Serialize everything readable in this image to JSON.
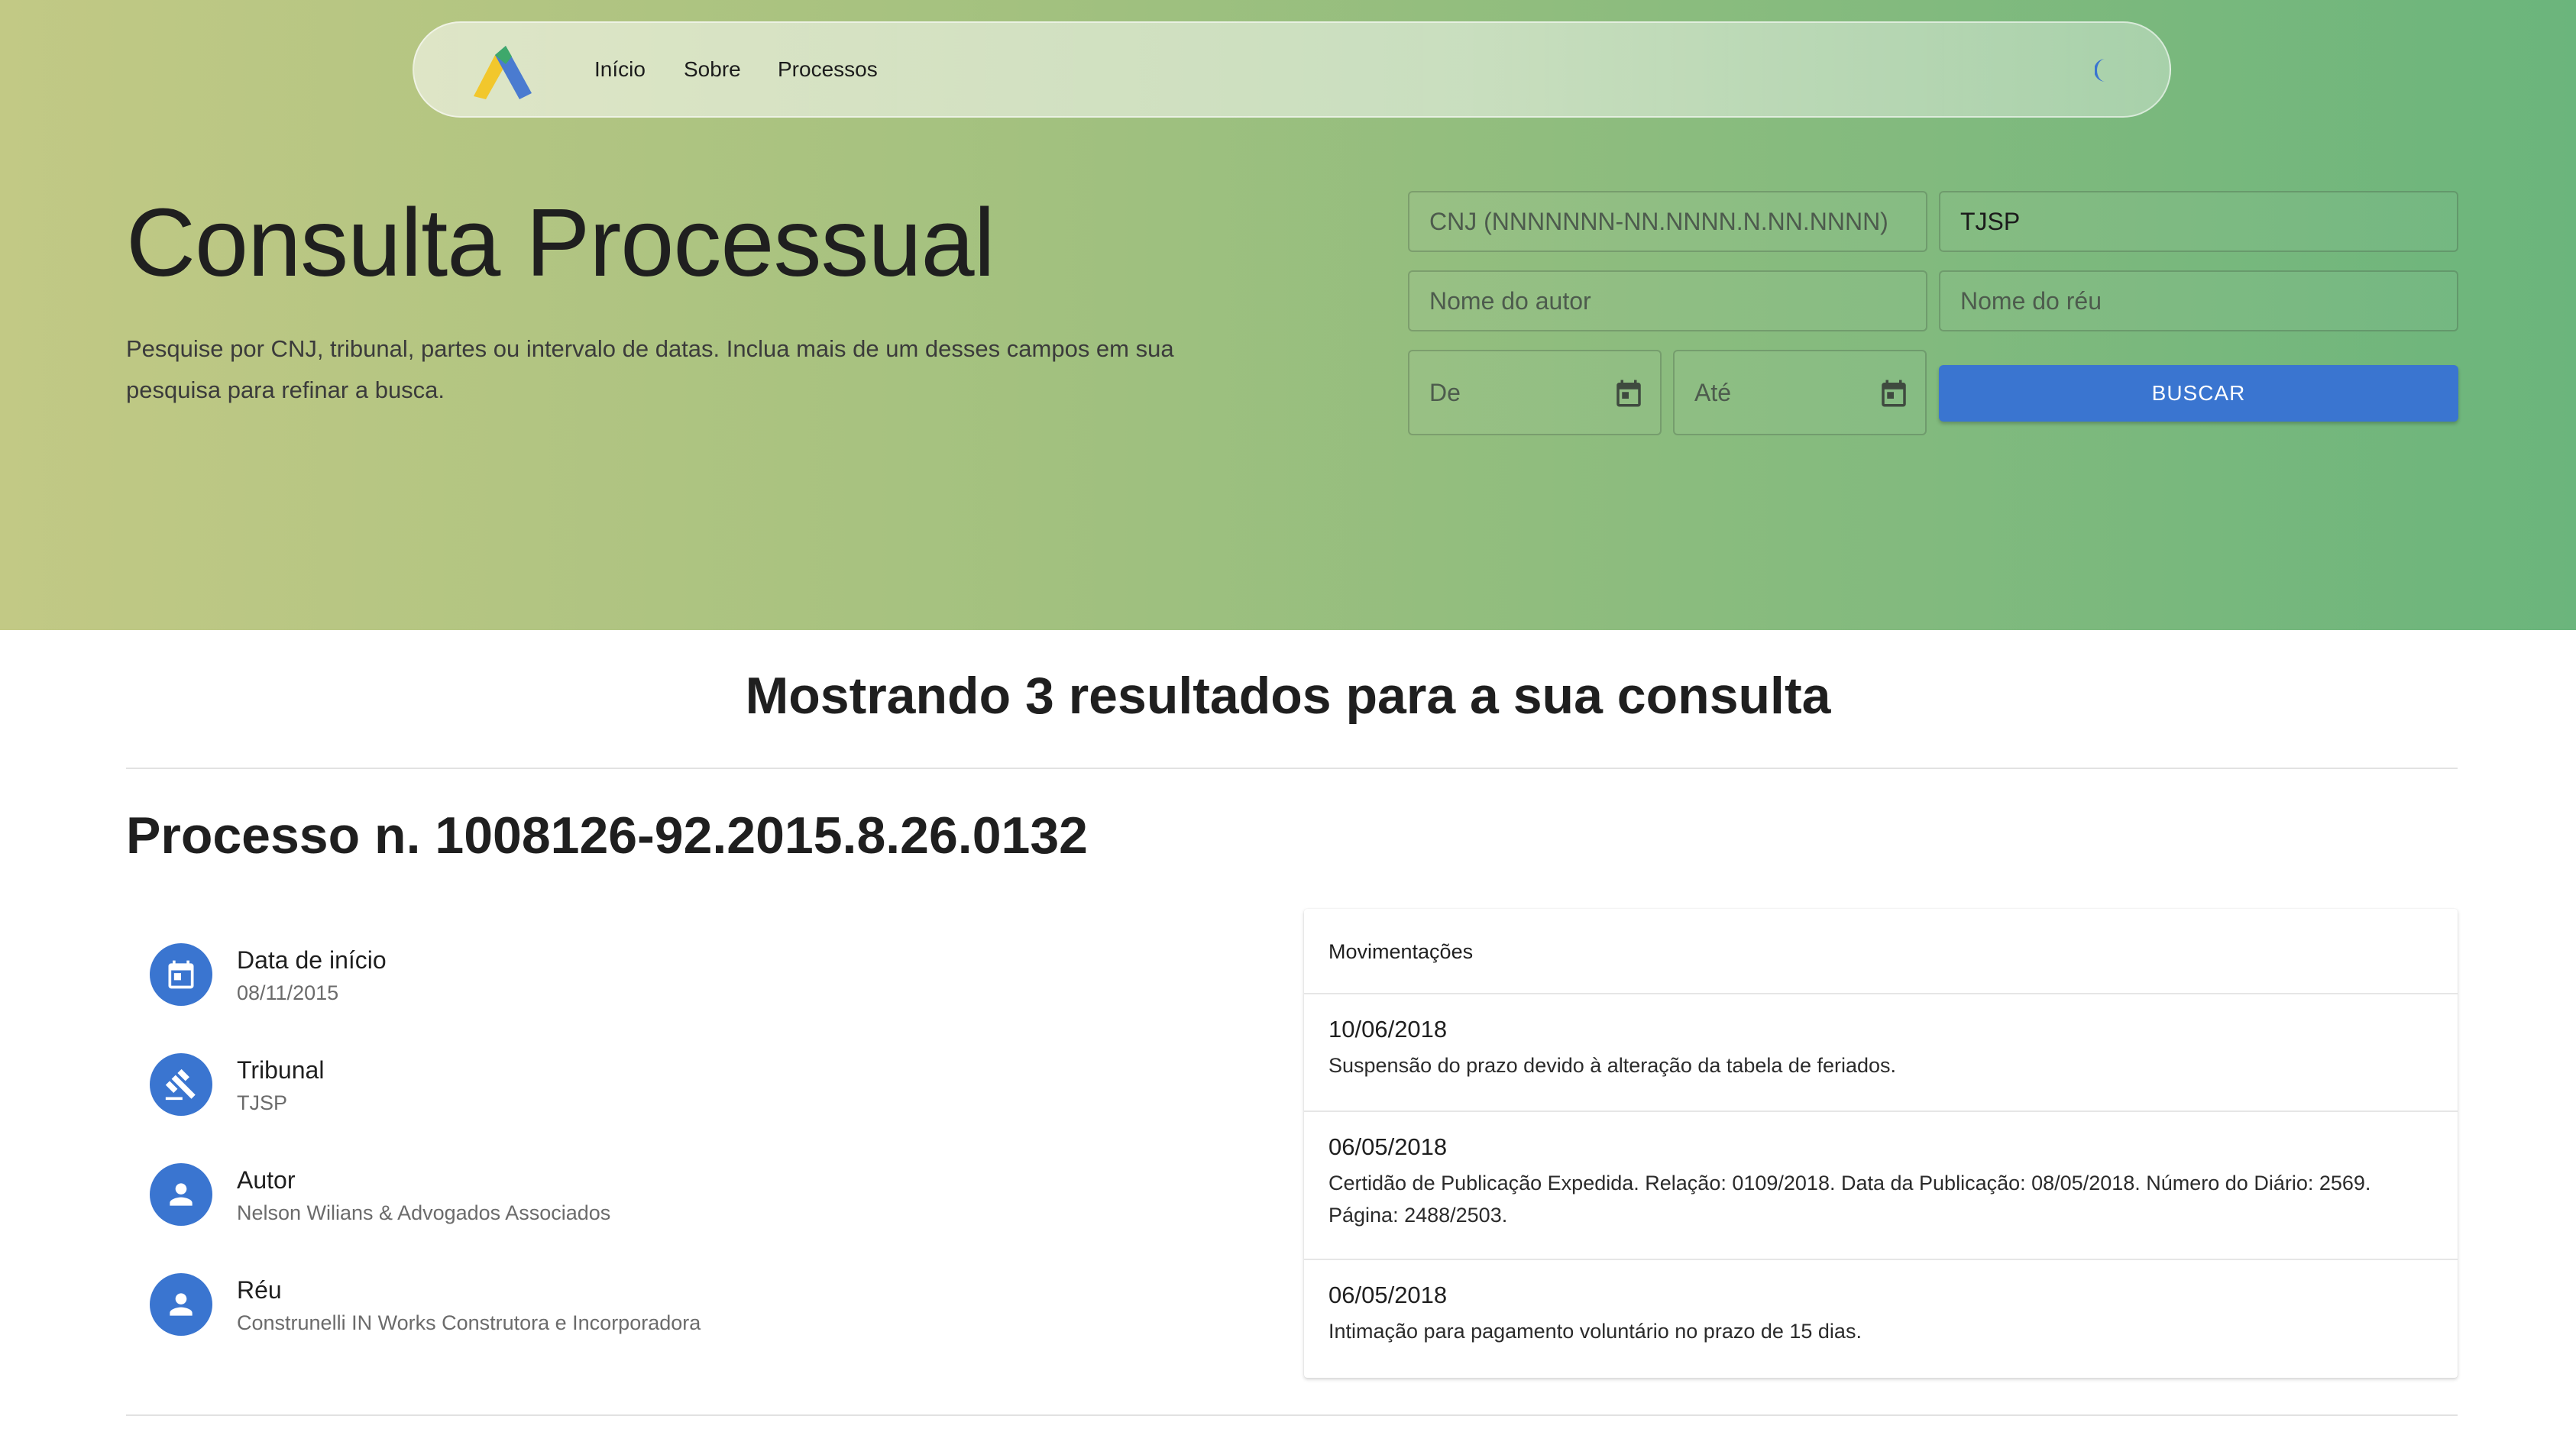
{
  "nav": {
    "links": [
      "Início",
      "Sobre",
      "Processos"
    ],
    "theme_toggle_icon": "moon-icon"
  },
  "hero": {
    "title": "Consulta Processual",
    "description": "Pesquise por CNJ, tribunal, partes ou intervalo de datas. Inclua mais de um desses campos em sua pesquisa para refinar a busca."
  },
  "search": {
    "cnj_placeholder": "CNJ (NNNNNNN-NN.NNNN.N.NN.NNNN)",
    "tribunal_value": "TJSP",
    "autor_placeholder": "Nome do autor",
    "reu_placeholder": "Nome do réu",
    "de_placeholder": "De",
    "ate_placeholder": "Até",
    "button_label": "BUSCAR"
  },
  "results": {
    "heading": "Mostrando 3 resultados para a sua consulta"
  },
  "process": {
    "title": "Processo n. 1008126-92.2015.8.26.0132",
    "info": [
      {
        "label": "Data de início",
        "value": "08/11/2015",
        "icon": "calendar-icon"
      },
      {
        "label": "Tribunal",
        "value": "TJSP",
        "icon": "gavel-icon"
      },
      {
        "label": "Autor",
        "value": "Nelson Wilians & Advogados Associados",
        "icon": "person-icon"
      },
      {
        "label": "Réu",
        "value": "Construnelli IN Works Construtora e Incorporadora",
        "icon": "person-icon"
      }
    ],
    "movimentacoes": {
      "header": "Movimentações",
      "items": [
        {
          "date": "10/06/2018",
          "text": "Suspensão do prazo devido à alteração da tabela de feriados."
        },
        {
          "date": "06/05/2018",
          "text": "Certidão de Publicação Expedida. Relação: 0109/2018. Data da Publicação: 08/05/2018. Número do Diário: 2569. Página: 2488/2503."
        },
        {
          "date": "06/05/2018",
          "text": "Intimação para pagamento voluntário no prazo de 15 dias."
        }
      ]
    }
  },
  "colors": {
    "primary": "#3a75d0",
    "gradient_start": "#c2c985",
    "gradient_end": "#6bb57c"
  }
}
